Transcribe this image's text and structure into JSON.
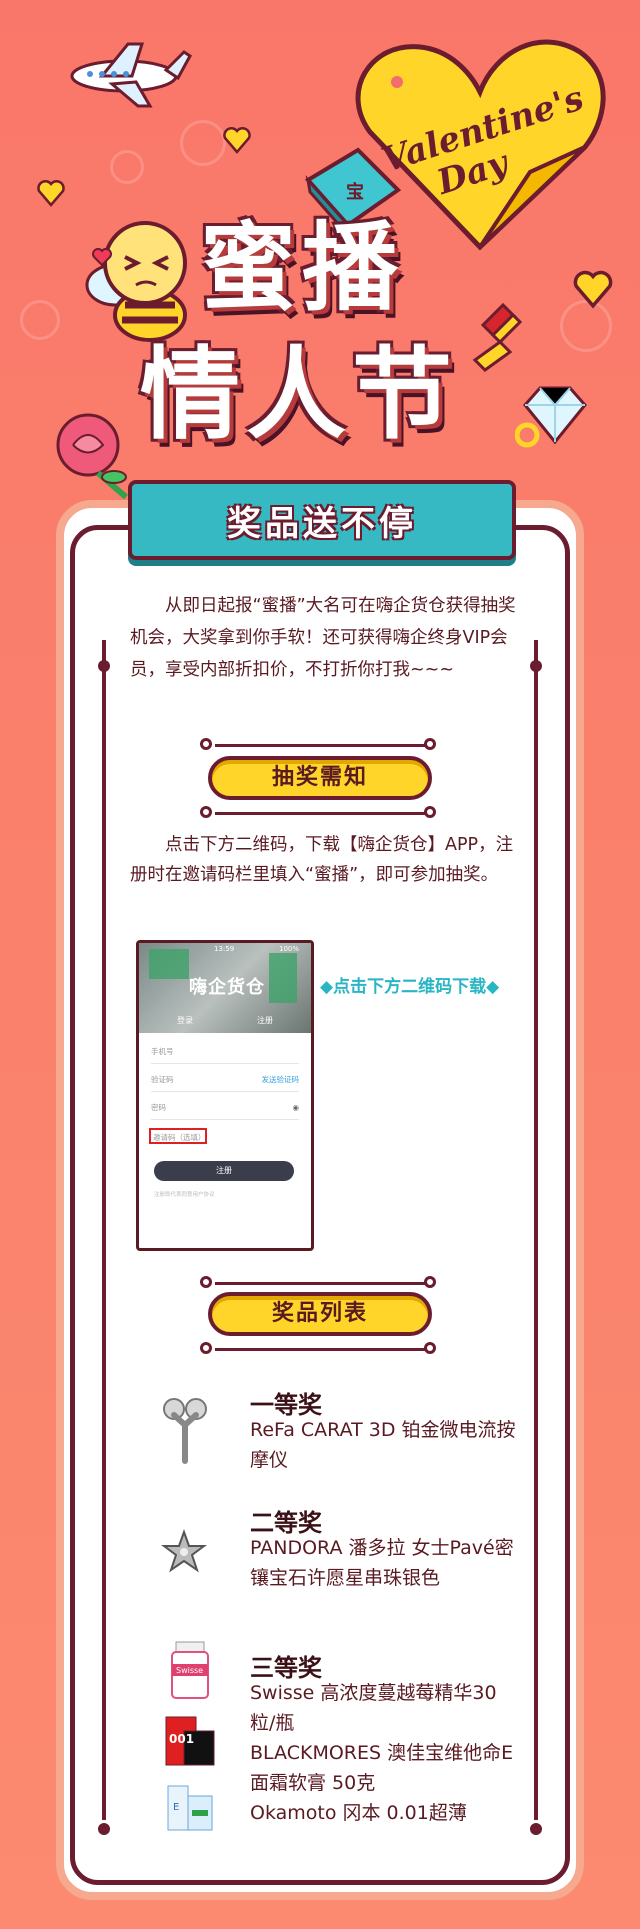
{
  "header": {
    "valentine_line1": "Valentine's",
    "valentine_line2": "Day",
    "title_line1": "蜜播",
    "title_line2": "情人节",
    "ribbon": "奖品送不停",
    "bag_logo": "宝"
  },
  "intro": {
    "text": "　　从即日起报“蜜播”大名可在嗨企货仓获得抽奖机会，大奖拿到你手软！还可获得嗨企终身VIP会员，享受内部折扣价，不打折你打我~~~"
  },
  "section1": {
    "title": "抽奖需知",
    "text": "　　点击下方二维码，下载【嗨企货仓】APP，注册时在邀请码栏里填入“蜜播”，即可参加抽奖。",
    "qr_hint": "◆点击下方二维码下载◆"
  },
  "phone": {
    "status": "13:59",
    "status_right": "100%",
    "brand": "嗨企货仓",
    "tab_login": "登录",
    "tab_register": "注册",
    "field_phone": "手机号",
    "field_code": "验证码",
    "send_code": "发送验证码",
    "field_password": "密码",
    "field_invite": "邀请码（选填）",
    "register_btn": "注册",
    "agreement": "注册即代表同意用户协议"
  },
  "section2": {
    "title": "奖品列表"
  },
  "prizes": [
    {
      "rank": "一等奖",
      "desc": "ReFa CARAT 3D  铂金微电流按摩仪"
    },
    {
      "rank": "二等奖",
      "desc": "PANDORA 潘多拉 女士Pavé密镶宝石许愿星串珠银色"
    },
    {
      "rank": "三等奖",
      "desc": "Swisse 高浓度蔓越莓精华30粒/瓶\nBLACKMORES 澳佳宝维他命E面霜软膏 50克\nOkamoto 冈本 0.01超薄"
    }
  ],
  "prize3_packs": {
    "swisse": "Swisse",
    "okamoto": "001",
    "blackmores": "E"
  },
  "colors": {
    "background": "#f9776a",
    "dark_maroon": "#6b1c2e",
    "yellow": "#ffd52a",
    "teal": "#36b9c2"
  }
}
